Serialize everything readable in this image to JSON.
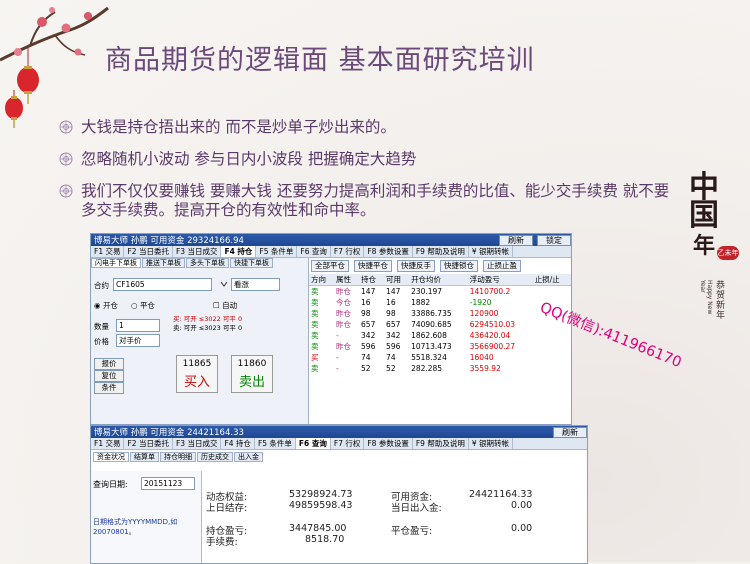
{
  "title": "商品期货的逻辑面 基本面研究培训",
  "bullets": [
    "大钱是持仓捂出来的 而不是炒单子炒出来的。",
    "忽略随机小波动 参与日内小波段 把握确定大趋势",
    "我们不仅仅要赚钱 要赚大钱 还要努力提高利润和手续费的比值、能少交手续费 就不要多交手续费。提高开仓的有效性和命中率。"
  ],
  "colors": {
    "title": "#6b4a7a",
    "accent_red": "#c2242a",
    "qq_pink": "#e0007a",
    "titlebar_blue": "#2c5aa8"
  },
  "decor": {
    "china_text": "中国",
    "nian": "年",
    "gongxi": "恭贺新年",
    "eng": "Happy New Year",
    "stamp": "乙未年"
  },
  "watermark": "QQ(微信):411966170",
  "win1": {
    "titlebar": "博易大师 孙鹏        可用资金 29324166.94",
    "btn_refresh": "刷新",
    "btn_lock": "锁定",
    "menu": [
      "F1 交易",
      "F2 当日委托",
      "F3 当日成交",
      "F4 持仓",
      "F5 条件单",
      "F6 查询",
      "F7 行权",
      "F8 参数设置",
      "F9 帮助及说明",
      "¥ 银期转帐"
    ],
    "subtabs": [
      "闪电手下单板",
      "推送下单板",
      "多头下单板",
      "快捷下单板"
    ],
    "contract_label": "合约",
    "contract_value": "CF1605",
    "contract_opt": "看涨",
    "open_label": "开仓",
    "close_label": "平仓",
    "auto_label": "自动",
    "buy_info": "买: 可开 ≤3022 可平 0",
    "sell_info": "卖: 可开 ≤3023 可平 0",
    "qty_label": "数量",
    "qty_value": "1",
    "price_label": "价格",
    "price_value": "对手价",
    "btn_quote": "报价",
    "btn_reset": "复位",
    "btn_cond": "条件",
    "buy_price": "11865",
    "buy_label": "买入",
    "sell_price": "11860",
    "sell_label": "卖出",
    "tools": [
      "全部平仓",
      "快捷平仓",
      "快捷反手",
      "快捷锁仓",
      "止损止盈"
    ],
    "pos_headers": [
      "方向",
      "属性",
      "持仓",
      "可用",
      "开仓均价",
      "浮动盈亏",
      "止损/止"
    ],
    "pos_rows": [
      [
        "卖",
        "昨仓",
        "147",
        "147",
        "230.197",
        "1410700.2",
        ""
      ],
      [
        "卖",
        "今仓",
        "16",
        "16",
        "1882",
        "-1920",
        ""
      ],
      [
        "卖",
        "昨仓",
        "98",
        "98",
        "33886.735",
        "120900",
        ""
      ],
      [
        "卖",
        "昨仓",
        "657",
        "657",
        "74090.685",
        "6294510.03",
        ""
      ],
      [
        "卖",
        "-",
        "342",
        "342",
        "1862.608",
        "436420.04",
        ""
      ],
      [
        "卖",
        "昨仓",
        "596",
        "596",
        "10713.473",
        "3566900.27",
        ""
      ],
      [
        "买",
        "-",
        "74",
        "74",
        "5518.324",
        "16040",
        ""
      ],
      [
        "卖",
        "-",
        "52",
        "52",
        "282.285",
        "3559.92",
        ""
      ]
    ]
  },
  "win2": {
    "titlebar": "博易大师 孙鹏        可用资金 24421164.33",
    "btn_refresh": "刷新",
    "menu": [
      "F1 交易",
      "F2 当日委托",
      "F3 当日成交",
      "F4 持仓",
      "F5 条件单",
      "F6 查询",
      "F7 行权",
      "F8 参数设置",
      "F9 帮助及说明",
      "¥ 银期转帐"
    ],
    "subtabs": [
      "资金状况",
      "结算单",
      "持仓明细",
      "历史成交",
      "出入金"
    ],
    "query_date_label": "查询日期:",
    "query_date_value": "20151123",
    "date_hint": "日期格式为YYYYMMDD,如20070801。",
    "dyn_equity_label": "动态权益:",
    "dyn_equity_value": "53298924.73",
    "prev_settle_label": "上日结存:",
    "prev_settle_value": "49859598.43",
    "avail_label": "可用资金:",
    "avail_value": "24421164.33",
    "inout_label": "当日出入金:",
    "inout_value": "0.00",
    "pos_pnl_label": "持仓盈亏:",
    "pos_pnl_value": "3447845.00",
    "fee_label": "手续费:",
    "fee_value": "8518.70",
    "close_pnl_label": "平仓盈亏:",
    "close_pnl_value": "0.00"
  }
}
